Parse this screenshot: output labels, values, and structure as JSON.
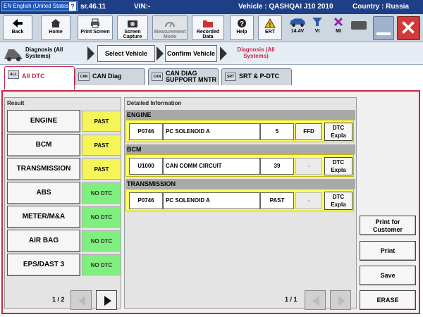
{
  "titlebar": {
    "language": "EN English (United States)",
    "help": "?",
    "version": "sr.46.11",
    "vin": "VIN:-",
    "vehicle": "Vehicle : QASHQAI J10 2010",
    "country": "Country : Russia"
  },
  "toolbar": {
    "back": "Back",
    "home": "Home",
    "print_screen": "Print Screen",
    "screen_capture": "Screen Capture",
    "measurement_mode": "Measurement Mode",
    "recorded_data": "Recorded Data",
    "help": "Help",
    "ert": "ERT",
    "voltage": "14.4V",
    "vi": "VI",
    "mi": "MI"
  },
  "breadcrumb": {
    "diagnosis_all_systems": "Diagnosis (All Systems)",
    "select_vehicle": "Select Vehicle",
    "confirm_vehicle": "Confirm Vehicle",
    "current": "Diagnosis (All Systems)"
  },
  "tabs": [
    {
      "label": "All DTC",
      "icon_label": "ALL"
    },
    {
      "label": "CAN Diag",
      "icon_label": "CAN"
    },
    {
      "label": "CAN DIAG SUPPORT MNTR",
      "icon_label": "CAN"
    },
    {
      "label": "SRT & P-DTC",
      "icon_label": "SRT"
    }
  ],
  "result": {
    "label": "Result",
    "rows": [
      {
        "system": "ENGINE",
        "status": "PAST"
      },
      {
        "system": "BCM",
        "status": "PAST"
      },
      {
        "system": "TRANSMISSION",
        "status": "PAST"
      },
      {
        "system": "ABS",
        "status": "NO DTC"
      },
      {
        "system": "METER/M&A",
        "status": "NO DTC"
      },
      {
        "system": "AIR BAG",
        "status": "NO DTC"
      },
      {
        "system": "EPS/DAST 3",
        "status": "NO DTC"
      }
    ],
    "page": "1 / 2"
  },
  "detail": {
    "label": "Detailed Information",
    "groups": [
      {
        "name": "ENGINE",
        "code": "P0746",
        "desc": "PC SOLENOID A",
        "count": "5",
        "ffd": "FFD",
        "dtc": "DTC Expla"
      },
      {
        "name": "BCM",
        "code": "U1000",
        "desc": "CAN COMM CIRCUIT",
        "count": "39",
        "ffd": "-",
        "dtc": "DTC Expla"
      },
      {
        "name": "TRANSMISSION",
        "code": "P0746",
        "desc": "PC SOLENOID A",
        "count": "PAST",
        "ffd": "-",
        "dtc": "DTC Expla"
      }
    ],
    "page": "1 / 1"
  },
  "actions": {
    "print_for_customer": "Print for Customer",
    "print": "Print",
    "save": "Save",
    "erase": "ERASE"
  },
  "colors": {
    "accent": "#c32a46",
    "past": "#f5f55a",
    "no_dtc": "#7ff07f",
    "highlight_row": "#ffff66",
    "titlebar": "#1e3f85"
  }
}
